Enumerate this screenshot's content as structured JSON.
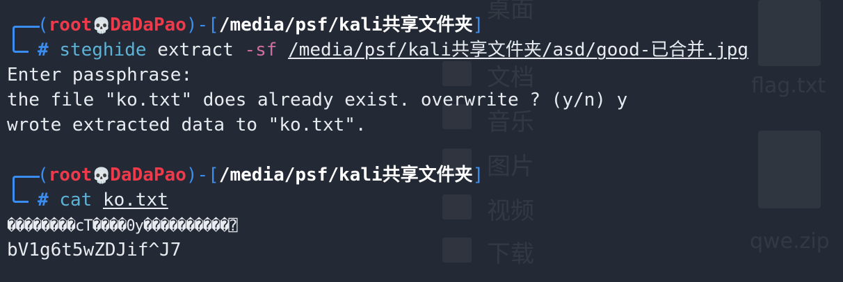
{
  "terminal": {
    "prompt": {
      "user": "root",
      "host": "DaDaPao",
      "skull_icon": "skull-icon",
      "cwd": "/media/psf/kali共享文件夹",
      "hash": "#"
    },
    "blocks": [
      {
        "command": "steghide",
        "args": [
          {
            "text": " extract ",
            "style": "plain"
          },
          {
            "text": "-sf",
            "style": "flag"
          },
          {
            "text": " ",
            "style": "plain"
          },
          {
            "text": "/media/psf/kali共享文件夹/asd/good-已合并.jpg",
            "style": "underline"
          }
        ],
        "output": [
          "Enter passphrase:",
          "the file \"ko.txt\" does already exist. overwrite ? (y/n) y",
          "wrote extracted data to \"ko.txt\"."
        ]
      },
      {
        "command": "cat",
        "args": [
          {
            "text": " ",
            "style": "plain"
          },
          {
            "text": "ko.txt",
            "style": "underline"
          }
        ],
        "output": [
          "��������cT����0y����������⍰",
          "bV1g6t5wZDJif^J7"
        ]
      }
    ]
  },
  "desktop_background": {
    "labels": [
      "桌面",
      "文档",
      "音乐",
      "图片",
      "视频",
      "下载",
      "flag.txt",
      "qwe.zip"
    ]
  }
}
